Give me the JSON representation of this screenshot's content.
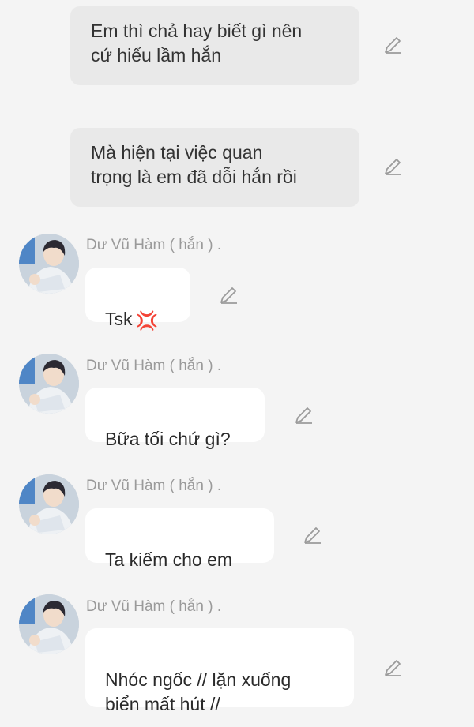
{
  "messages": [
    {
      "text": "Em thì chả hay biết gì nên\ncứ hiểu lầm hắn",
      "icon": "pencil-icon"
    },
    {
      "text": "Mà hiện tại việc quan\ntrọng là em đã dỗi hắn rồi",
      "icon": "pencil-icon"
    },
    {
      "sender": "Dư Vũ Hàm ( hắn ) .",
      "text": "Tsk",
      "emoji": "anger-symbol",
      "emoji_glyph": "💢",
      "icon": "pencil-icon"
    },
    {
      "sender": "Dư Vũ Hàm ( hắn ) .",
      "text": "Bữa tối chứ gì?",
      "icon": "pencil-icon"
    },
    {
      "sender": "Dư Vũ Hàm ( hắn ) .",
      "text": "Ta kiếm cho em",
      "icon": "pencil-icon"
    },
    {
      "sender": "Dư Vũ Hàm ( hắn ) .",
      "text": "Nhóc ngốc // lặn xuống\nbiển mất hút //",
      "icon": "pencil-icon"
    }
  ],
  "colors": {
    "background": "#f4f4f4",
    "gray_bubble": "#e9e9e9",
    "white_bubble": "#ffffff",
    "sender_text": "#9a9a9a",
    "anger_emoji": "#e8402f"
  }
}
